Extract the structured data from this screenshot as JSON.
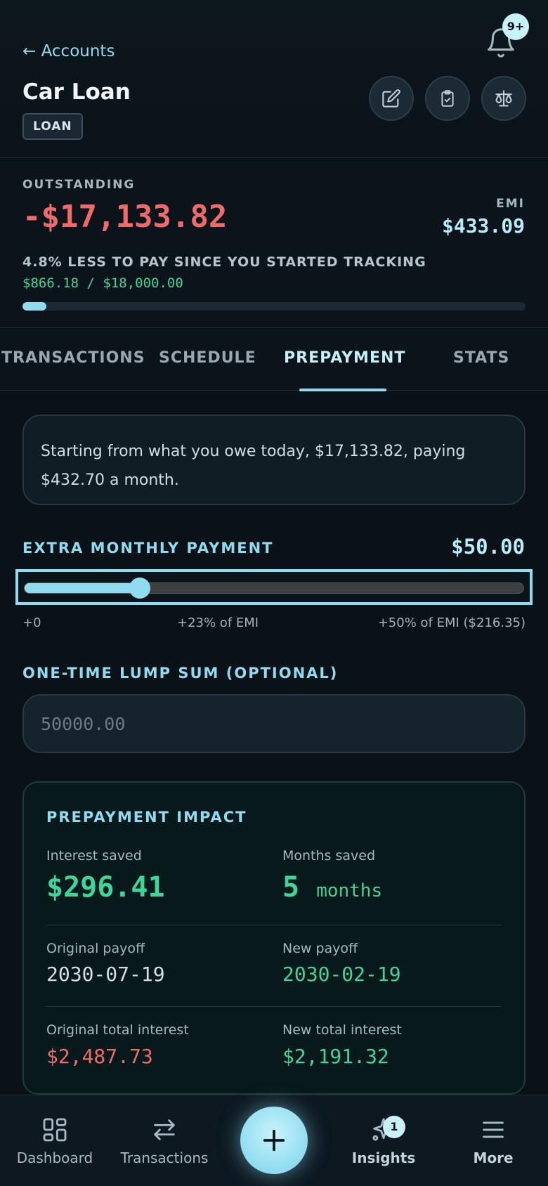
{
  "header": {
    "back_label": "← Accounts",
    "title": "Car Loan",
    "type_badge": "LOAN",
    "notifications_badge": "9+"
  },
  "summary": {
    "outstanding_label": "OUTSTANDING",
    "outstanding_value": "-$17,133.82",
    "emi_label": "EMI",
    "emi_value": "$433.09",
    "progress_text": "4.8% LESS TO PAY SINCE YOU STARTED TRACKING",
    "progress_amounts": "$866.18 / $18,000.00",
    "progress_fraction": 0.048
  },
  "tabs": [
    {
      "label": "TRANSACTIONS"
    },
    {
      "label": "SCHEDULE"
    },
    {
      "label": "PREPAYMENT"
    },
    {
      "label": "STATS"
    }
  ],
  "active_tab": "PREPAYMENT",
  "prepayment": {
    "info_text": "Starting from what you owe today, $17,133.82, paying $432.70 a month.",
    "extra_label": "EXTRA MONTHLY PAYMENT",
    "extra_value": "$50.00",
    "slider_fraction": 0.2311,
    "tick_min": "+0",
    "tick_mid": "+23% of EMI",
    "tick_max": "+50% of EMI ($216.35)",
    "lump_label": "ONE-TIME LUMP SUM (OPTIONAL)",
    "lump_placeholder": "50000.00",
    "lump_value": ""
  },
  "impact": {
    "title": "PREPAYMENT IMPACT",
    "interest_saved_label": "Interest saved",
    "interest_saved_value": "$296.41",
    "months_saved_label": "Months saved",
    "months_saved_value": "5",
    "months_saved_unit": "months",
    "original_payoff_label": "Original payoff",
    "original_payoff_value": "2030-07-19",
    "new_payoff_label": "New payoff",
    "new_payoff_value": "2030-02-19",
    "original_interest_label": "Original total interest",
    "original_interest_value": "$2,487.73",
    "new_interest_label": "New total interest",
    "new_interest_value": "$2,191.32"
  },
  "nav": {
    "dashboard": "Dashboard",
    "transactions": "Transactions",
    "insights": "Insights",
    "insights_badge": "1",
    "more": "More"
  },
  "colors": {
    "accent": "#8fdcf0",
    "negative": "#f16a6a",
    "positive": "#3ed598",
    "background": "#0a1117"
  },
  "icons": {
    "bell": "bell-icon",
    "edit": "edit-icon",
    "clipboard": "clipboard-check-icon",
    "scale": "scale-icon",
    "dashboard": "dashboard-icon",
    "transactions": "arrows-swap-icon",
    "add": "plus-icon",
    "insights": "sparkle-icon",
    "more": "menu-icon"
  }
}
